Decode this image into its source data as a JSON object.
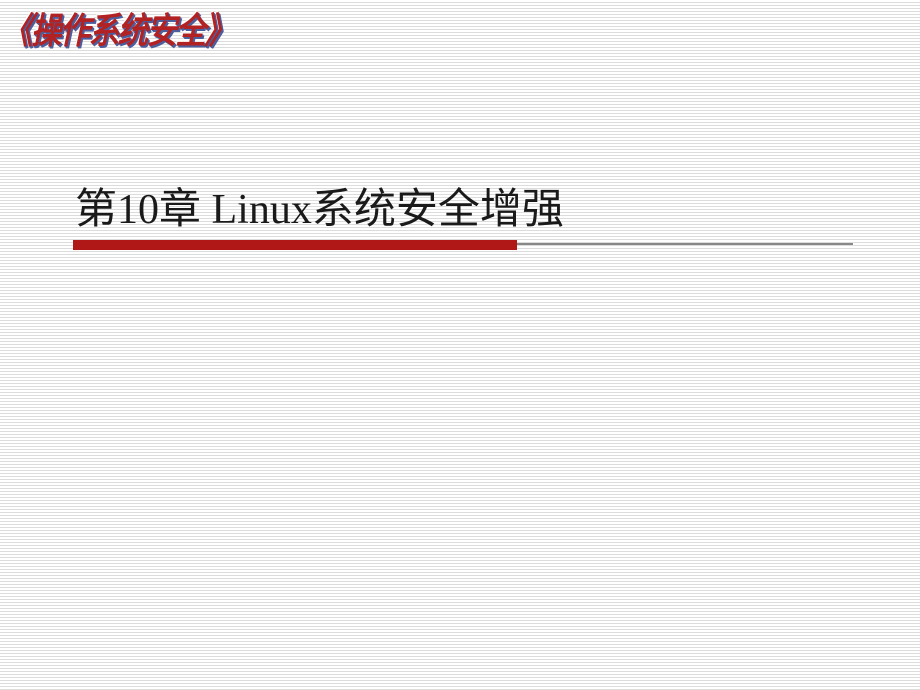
{
  "header": {
    "book_title": "《操作系统安全》"
  },
  "main": {
    "chapter_title": "第10章 Linux系统安全增强"
  },
  "colors": {
    "accent_red": "#b01818",
    "text_red": "#b22222",
    "shadow_blue": "#4b5e9e"
  }
}
